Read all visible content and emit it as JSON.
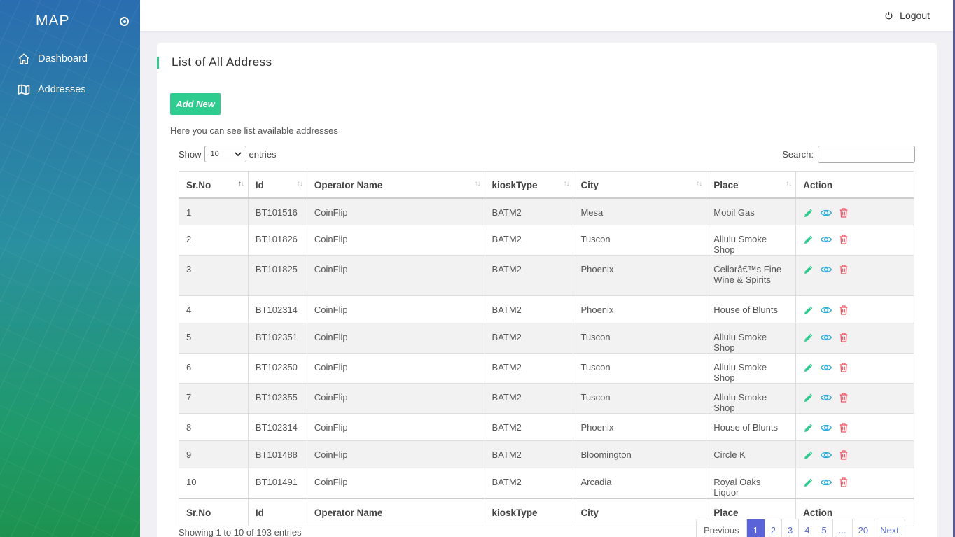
{
  "sidebar": {
    "brand": "MAP",
    "items": [
      {
        "label": "Dashboard",
        "icon": "home-icon"
      },
      {
        "label": "Addresses",
        "icon": "map-icon"
      }
    ]
  },
  "topbar": {
    "logout_label": "Logout"
  },
  "page": {
    "title": "List of All Address",
    "add_button": "Add New",
    "description": "Here you can see list available addresses"
  },
  "table_controls": {
    "show_label": "Show",
    "entries_value": "10",
    "entries_label": "entries",
    "search_label": "Search:"
  },
  "table": {
    "columns": [
      "Sr.No",
      "Id",
      "Operator Name",
      "kioskType",
      "City",
      "Place",
      "Action"
    ],
    "rows": [
      {
        "sr": "1",
        "id": "BT101516",
        "operator": "CoinFlip",
        "kiosk": "BATM2",
        "city": "Mesa",
        "place": "Mobil Gas"
      },
      {
        "sr": "2",
        "id": "BT101826",
        "operator": "CoinFlip",
        "kiosk": "BATM2",
        "city": "Tuscon",
        "place": "Allulu Smoke Shop"
      },
      {
        "sr": "3",
        "id": "BT101825",
        "operator": "CoinFlip",
        "kiosk": "BATM2",
        "city": "Phoenix",
        "place": "Cellarâ€™s Fine Wine & Spirits"
      },
      {
        "sr": "4",
        "id": "BT102314",
        "operator": "CoinFlip",
        "kiosk": "BATM2",
        "city": "Phoenix",
        "place": "House of Blunts"
      },
      {
        "sr": "5",
        "id": "BT102351",
        "operator": "CoinFlip",
        "kiosk": "BATM2",
        "city": "Tuscon",
        "place": "Allulu Smoke Shop"
      },
      {
        "sr": "6",
        "id": "BT102350",
        "operator": "CoinFlip",
        "kiosk": "BATM2",
        "city": "Tuscon",
        "place": "Allulu Smoke Shop"
      },
      {
        "sr": "7",
        "id": "BT102355",
        "operator": "CoinFlip",
        "kiosk": "BATM2",
        "city": "Tuscon",
        "place": "Allulu Smoke Shop"
      },
      {
        "sr": "8",
        "id": "BT102314",
        "operator": "CoinFlip",
        "kiosk": "BATM2",
        "city": "Phoenix",
        "place": "House of Blunts"
      },
      {
        "sr": "9",
        "id": "BT101488",
        "operator": "CoinFlip",
        "kiosk": "BATM2",
        "city": "Bloomington",
        "place": "Circle K"
      },
      {
        "sr": "10",
        "id": "BT101491",
        "operator": "CoinFlip",
        "kiosk": "BATM2",
        "city": "Arcadia",
        "place": "Royal Oaks Liquor"
      }
    ],
    "action_icons": [
      "edit-icon",
      "view-icon",
      "delete-icon"
    ]
  },
  "footer": {
    "info": "Showing 1 to 10 of 193 entries",
    "pagination": [
      "Previous",
      "1",
      "2",
      "3",
      "4",
      "5",
      "...",
      "20",
      "Next"
    ],
    "active_page": "1"
  },
  "colors": {
    "accent": "#2ecc8f",
    "pagination_active": "#5a63d8",
    "edit": "#2ecc8f",
    "view": "#2aa8d8",
    "delete": "#ef5a6a"
  }
}
